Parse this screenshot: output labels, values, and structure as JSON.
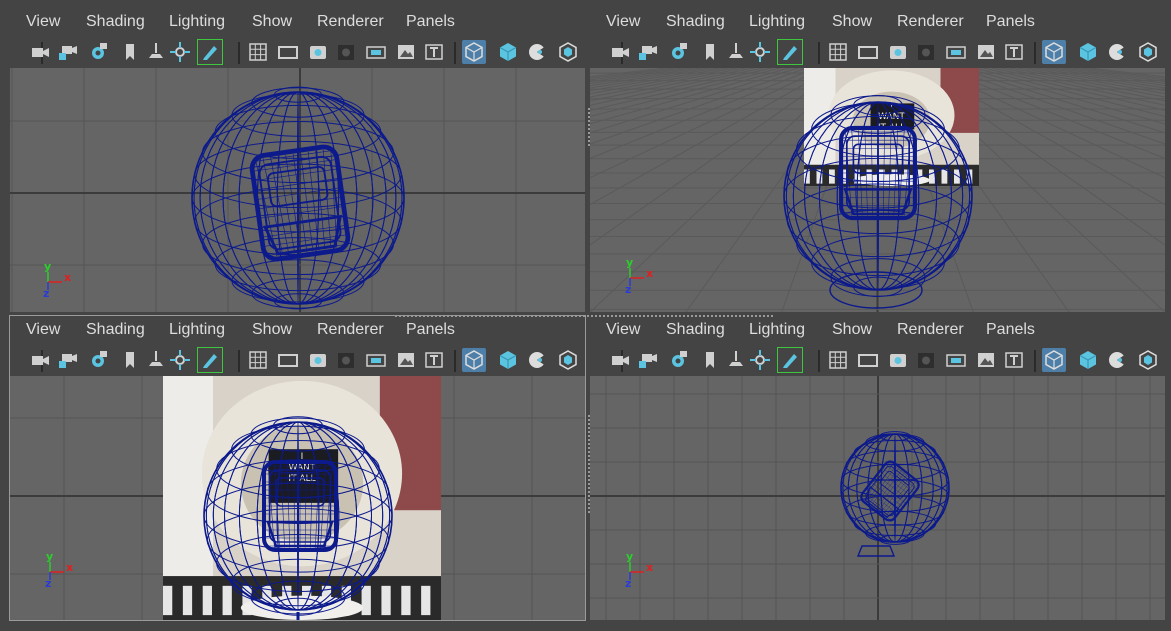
{
  "menus": [
    "View",
    "Shading",
    "Lighting",
    "Show",
    "Renderer",
    "Panels"
  ],
  "panels": [
    {
      "id": "top-left",
      "axis": {
        "up": "y",
        "right": "x",
        "out": "z"
      }
    },
    {
      "id": "top-right",
      "axis": {
        "up": "y",
        "right": "x",
        "out": "z"
      }
    },
    {
      "id": "bottom-left",
      "axis": {
        "up": "y",
        "right": "x",
        "out": "z"
      }
    },
    {
      "id": "bottom-right",
      "axis": {
        "up": "y",
        "right": "x",
        "out": "z"
      }
    }
  ],
  "toolbar_icons": [
    "camera-icon",
    "camera-lock-icon",
    "camera-attributes-icon",
    "bookmark-icon",
    "image-plane-icon",
    "frame-all-icon",
    "grease-pencil-icon",
    "grid-icon",
    "film-gate-icon",
    "resolution-gate-icon",
    "gate-mask-icon",
    "field-chart-icon",
    "safe-action-icon",
    "safe-title-icon",
    "wireframe-icon",
    "smooth-shade-icon",
    "textured-icon",
    "default-material-icon"
  ],
  "image_plane_text": [
    "I",
    "WANT",
    "IT ALL"
  ],
  "colors": {
    "wire": "#0c1a8c",
    "grid": "#555555",
    "grid_dark": "#3b3b3b",
    "axis_x": "#e02020",
    "axis_y": "#2ad02a",
    "axis_z": "#2a3cd8",
    "highlight": "#4d7fa8",
    "accent_green": "#3ec63e",
    "icon_blue": "#5bc4e0"
  }
}
